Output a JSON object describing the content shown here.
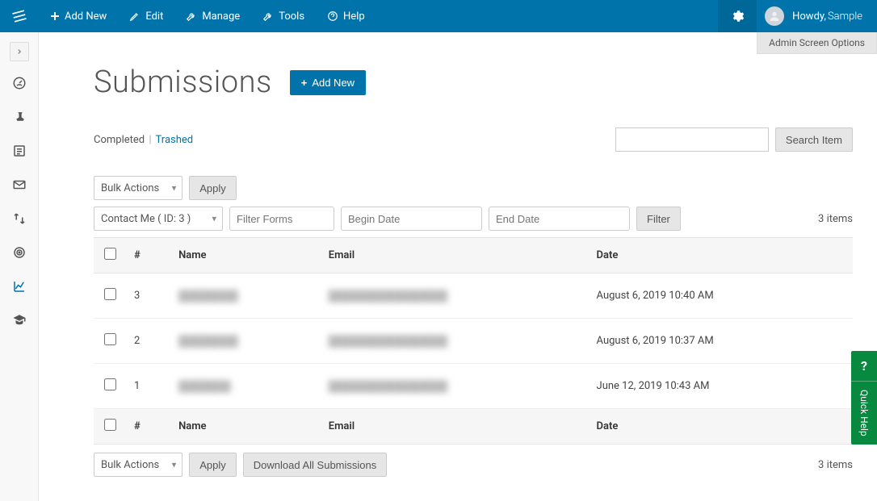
{
  "topbar": {
    "add_new": "Add New",
    "edit": "Edit",
    "manage": "Manage",
    "tools": "Tools",
    "help": "Help",
    "howdy_prefix": "Howdy, ",
    "user_name": "Sample"
  },
  "admin_options": "Admin Screen Options",
  "page": {
    "title": "Submissions",
    "add_new_button": "Add New"
  },
  "subsub": {
    "completed": "Completed",
    "trashed": "Trashed"
  },
  "search": {
    "button": "Search Item"
  },
  "bulk": {
    "label": "Bulk Actions",
    "apply": "Apply"
  },
  "filters": {
    "form_select": "Contact Me ( ID: 3 )",
    "filter_forms_placeholder": "Filter Forms",
    "begin_date_placeholder": "Begin Date",
    "end_date_placeholder": "End Date",
    "filter_button": "Filter"
  },
  "items_count": "3 items",
  "columns": {
    "num": "#",
    "name": "Name",
    "email": "Email",
    "date": "Date"
  },
  "rows": [
    {
      "num": "3",
      "name": "████████",
      "email": "████████████████",
      "date": "August 6, 2019 10:40 AM"
    },
    {
      "num": "2",
      "name": "████████",
      "email": "████████████████",
      "date": "August 6, 2019 10:37 AM"
    },
    {
      "num": "1",
      "name": "███████",
      "email": "████████████████",
      "date": "June 12, 2019 10:43 AM"
    }
  ],
  "download_button": "Download All Submissions",
  "quick_help": {
    "q": "?",
    "label": "Quick Help"
  }
}
